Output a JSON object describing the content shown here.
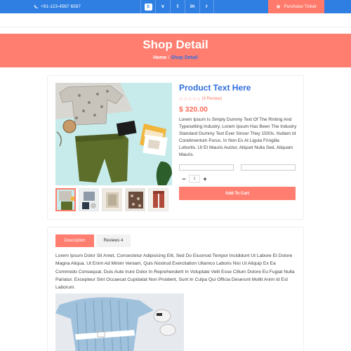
{
  "topbar": {
    "phone": "+91-123-4567 6587",
    "socials": [
      {
        "icon": "skype-icon",
        "glyph": "S"
      },
      {
        "icon": "vimeo-icon",
        "glyph": "v"
      },
      {
        "icon": "twitter-icon",
        "glyph": "t"
      },
      {
        "icon": "linkedin-icon",
        "glyph": "in"
      },
      {
        "icon": "rss-icon",
        "glyph": "r"
      }
    ],
    "ticket_label": "Purchase Ticket"
  },
  "banner": {
    "title": "Shop Detail",
    "crumb_home": "Home",
    "crumb_sep": " / ",
    "crumb_current": "Shop Detail"
  },
  "product": {
    "title": "Product Text Here",
    "stars": "☆☆☆☆☆",
    "reviews": "(4 Review)",
    "price": "$ 320.00",
    "description": "Lorem Ipsum Is Simply Dummy Text Of The Rinting And Typesetting Industry. Lorem Ipsum Has Been The Industry Standard Dummy Text Ever Sincer They 1500s. Nullam Id Condimentum Purus. In Non Ex At Ligula Fringilla Lobortis. Ut Et Mauris Auctor, Aliquet Nulla Sed, Aliquam Mauris.",
    "quantity": "1",
    "minus": "−",
    "plus": "+",
    "add_to_cart": "Add To Cart"
  },
  "tabs": {
    "description": "Description",
    "reviews": "Reviews 4"
  },
  "long_description": "Lorem Ipsum Dolor Sit Amet, Consectetur Adipisicing Elit, Sed Do Eiusmod Tempor Incididunt Ut Labore Et Dolore Magna Aliqua. Ut Enim Ad Minim Veniam, Quis Nostrud Exercitation Ullamco Laboris Nisi Ut Aliquip Ex Ea Commodo Consequat. Duis Aute Irure Dolor In Reprehenderit In Voluptate Velit Esse Cillum Dolore Eu Fugiat Nulla Pariatur. Excepteur Sint Occaecat Cupidatat Non Proident, Sunt In Culpa Qui Officia Deserunt Mollit Anim Id Est Laborum.",
  "colors": {
    "brand_blue": "#2f7fe3",
    "accent_coral": "#ff7e6f"
  }
}
